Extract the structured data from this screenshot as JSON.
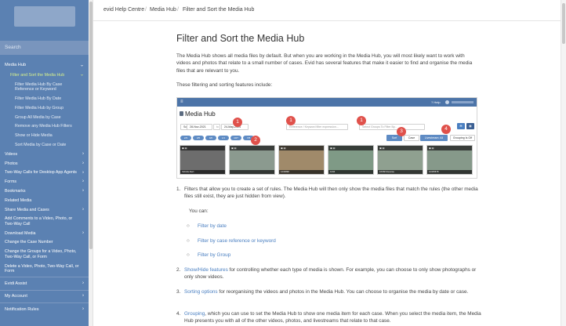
{
  "sidebar": {
    "search_placeholder": "Search",
    "items": [
      {
        "label": "Media Hub",
        "chev": "⌄"
      },
      {
        "label": "Filter and Sort the Media Hub",
        "chev": "⌄"
      },
      {
        "label": "Filter Media Hub By Case Reference or Keyword"
      },
      {
        "label": "Filter Media Hub By Date"
      },
      {
        "label": "Filter Media Hub by Group"
      },
      {
        "label": "Group All Media by Case"
      },
      {
        "label": "Remove any Media Hub Filters"
      },
      {
        "label": "Show or Hide Media"
      },
      {
        "label": "Sort Media by Case or Date"
      },
      {
        "label": "Videos",
        "chev": "›"
      },
      {
        "label": "Photos",
        "chev": "›"
      },
      {
        "label": "Two-Way Calls for Desktop App Agents",
        "chev": "›"
      },
      {
        "label": "Forms",
        "chev": "›"
      },
      {
        "label": "Bookmarks",
        "chev": "›"
      },
      {
        "label": "Related Media"
      },
      {
        "label": "Share Media and Cases",
        "chev": "›"
      },
      {
        "label": "Add Comments to a Video, Photo, or Two-Way Call"
      },
      {
        "label": "Download Media",
        "chev": "›"
      },
      {
        "label": "Change the Case Number"
      },
      {
        "label": "Change the Groups for a Video, Photo, Two-Way Call, or Form"
      },
      {
        "label": "Delete a Video, Photo, Two-Way Call, or Form"
      },
      {
        "label": "Evidi Assist",
        "chev": "›"
      },
      {
        "label": "My Account",
        "chev": "›"
      },
      {
        "label": "Notification Rules",
        "chev": "›"
      }
    ]
  },
  "breadcrumb": {
    "items": [
      "evid Help Centre",
      "Media Hub",
      "Filter and Sort the Media Hub"
    ],
    "separator": "/"
  },
  "page": {
    "title": "Filter and Sort the Media Hub",
    "intro": "The Media Hub shows all media files by default. But when you are working in the Media Hub, you will most likely want to work with videos and photos that relate to a small number of cases. Evid has several features that make it easier to find and organise the media files that are relevant to you.",
    "features_intro": "These filtering and sorting features include:"
  },
  "screenshot": {
    "help": "? Help",
    "title": "Media Hub",
    "sort_label": "Sort",
    "date_from": "28-Nov-2021",
    "to_label": "to",
    "date_to": "24-May-2024",
    "ref_placeholder": "Reference / Keyword filter expression...",
    "groups_placeholder": "Select Groups To Filter By...",
    "btn_sort": "Sort",
    "btn_case": "Case",
    "btn_livestream": "Livestream: All",
    "btn_grouping": "Grouping Is Off",
    "pills": [
      "2/3",
      "3/5",
      "0/0",
      "1/1",
      "10/7",
      "7/8"
    ],
    "badges": [
      "1",
      "1",
      "1",
      "2",
      "3",
      "4"
    ],
    "thumbs": [
      "Vehicle Alert",
      "",
      "1234890",
      "1234",
      "16/09/ Reverse",
      "12345678"
    ]
  },
  "list": [
    {
      "num": "1.",
      "text": "Filters that allow you to create a set of rules. The Media Hub will then only show the media files that match the rules (the other media files still exist, they are just hidden from view).",
      "you_can": "You can:",
      "subs": [
        "Filter by date",
        "Filter by case reference or keyword",
        "Filter by Group"
      ]
    },
    {
      "num": "2.",
      "link": "Show/Hide features",
      "text": " for controlling whether each type of media is shown. For example, you can choose to only show photographs or only show videos."
    },
    {
      "num": "3.",
      "link": "Sorting options",
      "text": " for reorganising the videos and photos in the Media Hub. You can choose to organise the media by date or case."
    },
    {
      "num": "4.",
      "link": "Grouping",
      "text": ", which you can use to set the Media Hub to show one media item for each case. When you select the media item, the Media Hub presents you with all of the other videos, photos, and livestreams that relate to that case."
    }
  ]
}
